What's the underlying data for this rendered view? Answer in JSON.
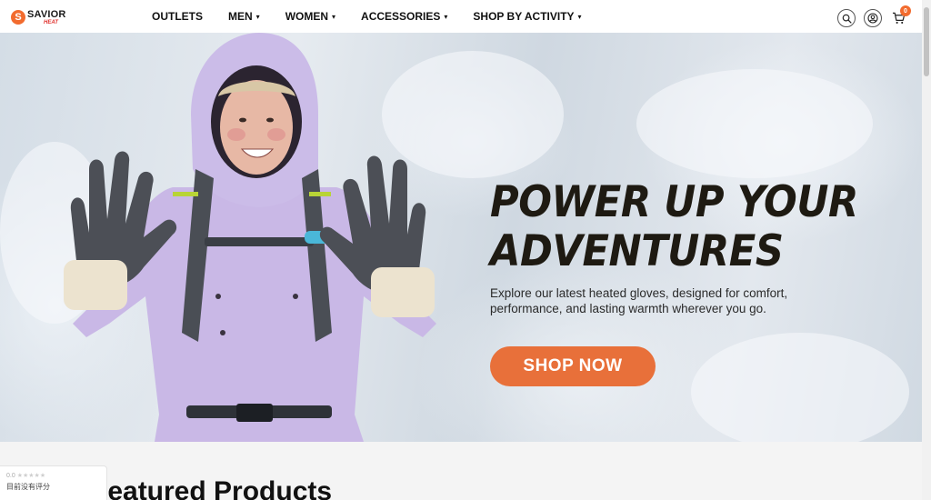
{
  "brand": {
    "name": "SAVIOR",
    "sub": "HEAT",
    "logo_letter": "S",
    "accent_color": "#f26b2e"
  },
  "nav": {
    "items": [
      {
        "label": "OUTLETS",
        "has_dropdown": false
      },
      {
        "label": "MEN",
        "has_dropdown": true
      },
      {
        "label": "WOMEN",
        "has_dropdown": true
      },
      {
        "label": "ACCESSORIES",
        "has_dropdown": true
      },
      {
        "label": "SHOP BY ACTIVITY",
        "has_dropdown": true
      }
    ],
    "caret": "▾"
  },
  "header_icons": {
    "search": "search-icon",
    "account": "user-icon",
    "cart": "cart-icon",
    "cart_count": "0"
  },
  "hero": {
    "title_line1": "POWER UP YOUR",
    "title_line2": "ADVENTURES",
    "subtitle": "Explore our latest heated gloves, designed for comfort, performance, and lasting warmth wherever you go.",
    "cta_label": "SHOP NOW",
    "cta_color": "#e8703a",
    "image_subject": "person in lavender ski jacket wearing heated gloves in snow"
  },
  "section": {
    "title": "Featured Products"
  },
  "review_widget": {
    "score": "0.0",
    "stars": "★★★★★",
    "text": "目前没有评分"
  }
}
